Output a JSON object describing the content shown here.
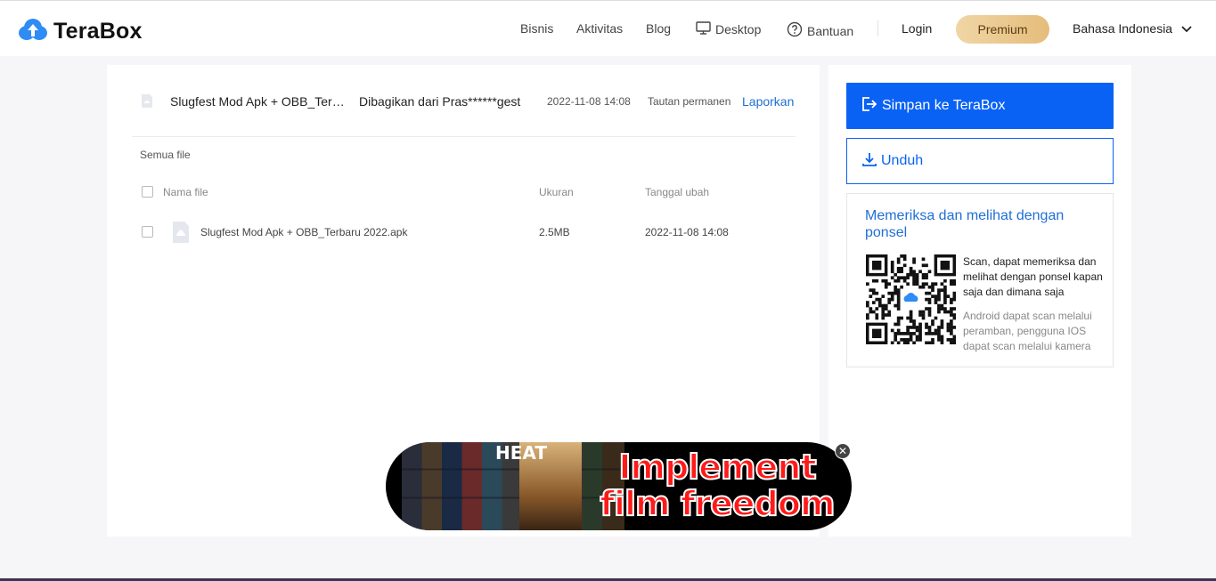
{
  "brand": {
    "name": "TeraBox"
  },
  "nav": {
    "items": [
      "Bisnis",
      "Aktivitas",
      "Blog",
      "Desktop",
      "Bantuan"
    ],
    "login": "Login",
    "premium": "Premium",
    "language": "Bahasa Indonesia"
  },
  "share": {
    "title": "Slugfest Mod Apk + OBB_Terbaru 2022.apk",
    "from": "Dibagikan dari Pras******gest",
    "date": "2022-11-08 14:08",
    "permalink": "Tautan permanen",
    "report": "Laporkan"
  },
  "files": {
    "breadcrumb": "Semua file",
    "columns": {
      "name": "Nama file",
      "size": "Ukuran",
      "modified": "Tanggal ubah"
    },
    "rows": [
      {
        "name": "Slugfest Mod Apk + OBB_Terbaru 2022.apk",
        "size": "2.5MB",
        "modified": "2022-11-08 14:08"
      }
    ]
  },
  "side": {
    "save_label": "Simpan ke TeraBox",
    "download_label": "Unduh",
    "scan_title": "Memeriksa dan melihat dengan ponsel",
    "scan_text": "Scan, dapat memeriksa dan melihat dengan ponsel kapan saja dan dimana saja",
    "scan_sub": "Android dapat scan melalui peramban, pengguna IOS dapat scan melalui kamera"
  },
  "ad": {
    "line1": "Implement",
    "line2": "film freedom",
    "heat": "HEAT"
  },
  "colors": {
    "accent": "#0a62f5",
    "link": "#1f6fd6",
    "premium": "#e5bc7a"
  },
  "icons": [
    "terabox-cloud-icon",
    "desktop-icon",
    "help-circle-icon",
    "chevron-down-icon",
    "file-icon",
    "save-icon",
    "download-icon",
    "qr-code-icon",
    "close-icon"
  ]
}
